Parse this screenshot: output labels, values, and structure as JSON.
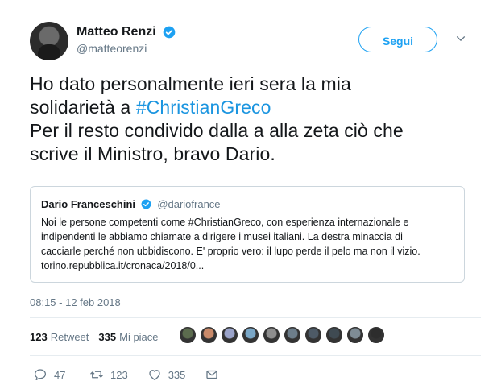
{
  "author": {
    "name": "Matteo Renzi",
    "handle": "@matteorenzi",
    "verified": true
  },
  "follow_button": "Segui",
  "tweet": {
    "line1": "Ho dato personalmente ieri sera la mia",
    "line2_prefix": "solidarietà a ",
    "line2_hashtag": "#ChristianGreco",
    "line3": "Per il resto condivido dalla a alla zeta ciò che",
    "line4": "scrive il Ministro, bravo Dario."
  },
  "quoted": {
    "name": "Dario Franceschini",
    "handle": "@dariofrance",
    "lines": [
      "Noi le persone competenti come #ChristianGreco, con esperienza internazionale e",
      "indipendenti le abbiamo chiamate a dirigere i musei italiani. La destra minaccia di",
      "cacciarle perché non ubbidiscono. E' proprio vero: il lupo perde il pelo ma non il vizio.",
      "torino.repubblica.it/cronaca/2018/0..."
    ]
  },
  "timestamp": "08:15 - 12 feb 2018",
  "stats": {
    "retweets": "123",
    "retweets_label": "Retweet",
    "likes": "335",
    "likes_label": "Mi piace"
  },
  "liker_avatar_colors": [
    "#5b6b4e",
    "#c98a6a",
    "#9aa3c9",
    "#7aa7c7",
    "#8e8e8e",
    "#6c7d8a",
    "#4d5a66",
    "#3f4a52",
    "#7e8c95",
    "#2d2d2d"
  ],
  "actions": {
    "replies": "47",
    "retweets": "123",
    "likes": "335"
  },
  "colors": {
    "accent": "#1da1f2",
    "hashtag": "#1b95e0",
    "muted": "#657786",
    "text": "#14171a"
  }
}
